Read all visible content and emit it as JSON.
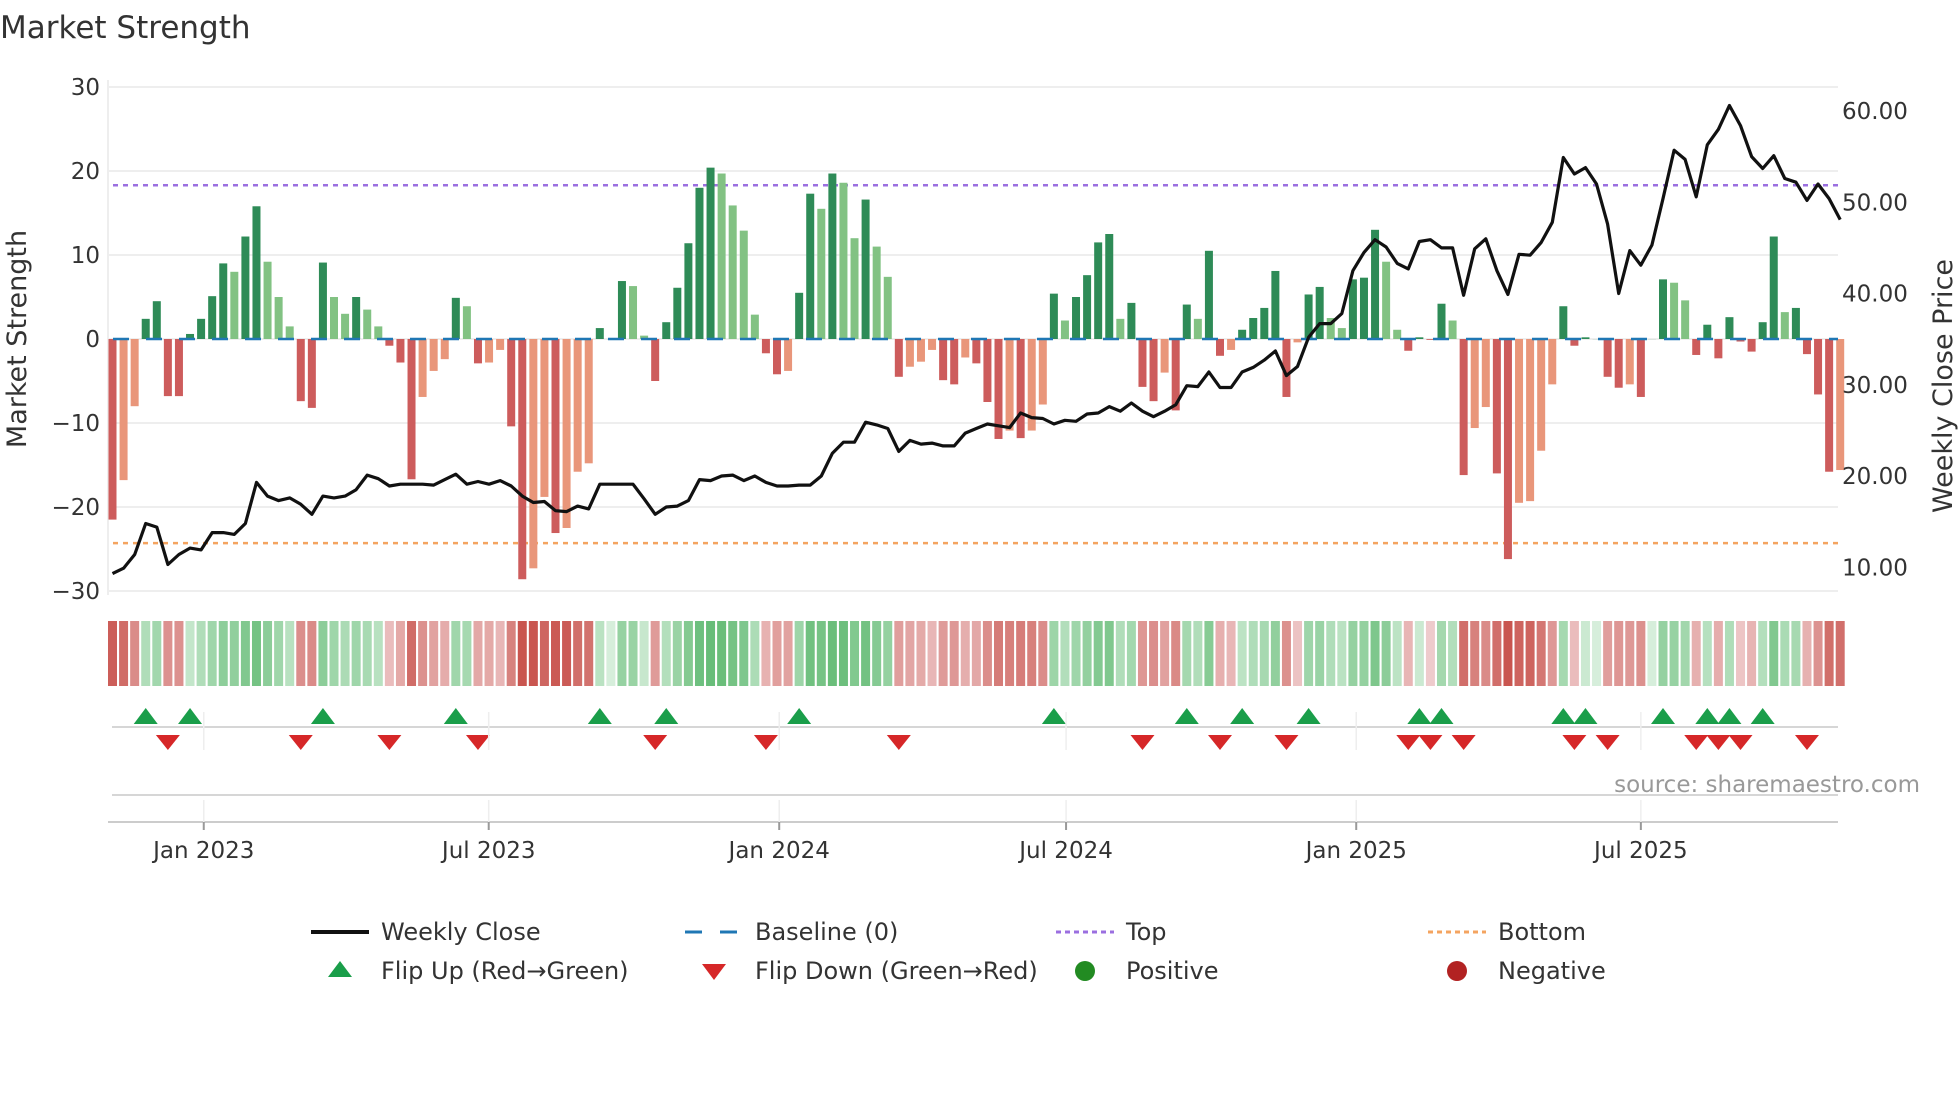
{
  "chart_data": {
    "type": "bar",
    "title": "Market Strength",
    "ylabel": "Market Strength",
    "y2label": "Weekly Close Price",
    "ylim": [
      -30,
      30
    ],
    "y2lim": [
      10,
      60
    ],
    "yticks": [
      "30",
      "20",
      "10",
      "0",
      "−10",
      "−20",
      "−30"
    ],
    "ytick_values": [
      30,
      20,
      10,
      0,
      -10,
      -20,
      -30
    ],
    "y2ticks": [
      "60.00",
      "50.00",
      "40.00",
      "30.00",
      "20.00",
      "10.00"
    ],
    "y2tick_values": [
      60,
      50,
      40,
      30,
      20,
      10
    ],
    "xticks": [
      {
        "label": "Jan 2023",
        "week": 8.24
      },
      {
        "label": "Jul 2023",
        "week": 33.97
      },
      {
        "label": "Jan 2024",
        "week": 60.2
      },
      {
        "label": "Jul 2024",
        "week": 86.1
      },
      {
        "label": "Jan 2025",
        "week": 112.3
      },
      {
        "label": "Jul 2025",
        "week": 138.0
      }
    ],
    "top_level": 18.3,
    "bottom_level": -24.3,
    "strength": [
      -21.5,
      -16.8,
      -8,
      2.4,
      4.5,
      -6.8,
      -6.8,
      0.6,
      2.4,
      5.1,
      9,
      8,
      12.2,
      15.8,
      9.2,
      5,
      1.5,
      -7.4,
      -8.2,
      9.1,
      5,
      3,
      5,
      3.5,
      1.5,
      -0.8,
      -2.8,
      -16.7,
      -6.9,
      -3.8,
      -2.4,
      4.9,
      3.9,
      -2.9,
      -2.8,
      -1.3,
      -10.4,
      -28.6,
      -27.3,
      -18.8,
      -23.1,
      -22.5,
      -15.8,
      -14.8,
      1.3,
      0,
      6.9,
      6.3,
      0.4,
      -5,
      2,
      6.1,
      11.4,
      18,
      20.4,
      19.7,
      15.9,
      12.9,
      2.9,
      -1.7,
      -4.2,
      -3.8,
      5.5,
      17.3,
      15.5,
      19.7,
      18.6,
      12,
      16.6,
      11,
      7.4,
      -4.5,
      -3.3,
      -2.7,
      -1.3,
      -4.9,
      -5.4,
      -2.2,
      -2.9,
      -7.5,
      -11.9,
      -10.9,
      -11.8,
      -10.9,
      -7.8,
      5.4,
      2.2,
      5,
      7.6,
      11.5,
      12.5,
      2.4,
      4.3,
      -5.7,
      -7.4,
      -4,
      -8.5,
      4.1,
      2.4,
      10.5,
      -2,
      -1.3,
      1.1,
      2.5,
      3.7,
      8.1,
      -6.9,
      -0.4,
      5.3,
      6.2,
      2.5,
      1.3,
      7.1,
      7.3,
      13,
      9.2,
      1.1,
      -1.4,
      0.2,
      -0.1,
      4.2,
      2.2,
      -16.2,
      -10.6,
      -8.1,
      -16,
      -26.2,
      -19.5,
      -19.3,
      -13.3,
      -5.4,
      3.9,
      -0.8,
      0.2,
      0,
      -4.5,
      -5.8,
      -5.4,
      -6.9,
      0,
      7.1,
      6.7,
      4.6,
      -1.9,
      1.7,
      -2.3,
      2.6,
      -0.3,
      -1.5,
      2,
      12.2,
      3.2,
      3.7,
      -1.8,
      -6.6,
      -15.8,
      -15.6
    ],
    "weekly_close": [
      9.3,
      9.9,
      11.4,
      14.8,
      14.4,
      10.3,
      11.4,
      12.1,
      11.9,
      13.8,
      13.8,
      13.6,
      14.8,
      19.3,
      17.8,
      17.3,
      17.6,
      16.9,
      15.8,
      17.8,
      17.6,
      17.8,
      18.5,
      20.1,
      19.7,
      18.9,
      19.1,
      19.1,
      19.1,
      19.0,
      19.6,
      20.2,
      19.1,
      19.4,
      19.1,
      19.5,
      18.9,
      17.8,
      17.1,
      17.2,
      16.2,
      16.1,
      16.7,
      16.4,
      19.1,
      19.1,
      19.1,
      19.1,
      17.5,
      15.8,
      16.6,
      16.7,
      17.3,
      19.6,
      19.5,
      20.0,
      20.1,
      19.5,
      20.0,
      19.3,
      18.9,
      18.9,
      19.0,
      19.0,
      20.0,
      22.5,
      23.7,
      23.7,
      25.9,
      25.6,
      25.2,
      22.7,
      23.9,
      23.5,
      23.6,
      23.3,
      23.3,
      24.7,
      25.2,
      25.7,
      25.5,
      25.3,
      26.9,
      26.4,
      26.3,
      25.7,
      26.1,
      26.0,
      26.8,
      26.9,
      27.6,
      27.1,
      28.0,
      27.1,
      26.5,
      27.1,
      27.8,
      29.9,
      29.8,
      31.4,
      29.7,
      29.7,
      31.4,
      31.9,
      32.7,
      33.7,
      31.0,
      32.0,
      35.2,
      36.7,
      36.7,
      37.8,
      42.5,
      44.5,
      45.9,
      45.1,
      43.3,
      42.7,
      45.7,
      45.9,
      45.0,
      45.0,
      39.8,
      44.9,
      46.0,
      42.5,
      39.9,
      44.3,
      44.2,
      45.6,
      47.8,
      54.9,
      53.1,
      53.8,
      52.0,
      47.6,
      40.0,
      44.7,
      43.1,
      45.3,
      50.4,
      55.7,
      54.7,
      50.6,
      56.3,
      58.0,
      60.6,
      58.4,
      55.0,
      53.7,
      55.1,
      52.6,
      52.2,
      50.2,
      52.0,
      50.4,
      48.1
    ],
    "flip_up_weeks": [
      3,
      7,
      19,
      31,
      44,
      50,
      62,
      85,
      97,
      102,
      108,
      118,
      120,
      131,
      133,
      140,
      144,
      146,
      149
    ],
    "flip_down_weeks": [
      5,
      17,
      25,
      33,
      49,
      59,
      71,
      93,
      100,
      106,
      117,
      119,
      122,
      132,
      135,
      143,
      145,
      147,
      153
    ],
    "legend": {
      "placement": "bottom",
      "items": [
        {
          "label": "Weekly Close",
          "kind": "line"
        },
        {
          "label": "Baseline (0)",
          "kind": "dash"
        },
        {
          "label": "Top",
          "kind": "dot-top"
        },
        {
          "label": "Bottom",
          "kind": "dot-bottom"
        },
        {
          "label": "Flip Up (Red→Green)",
          "kind": "tri-up"
        },
        {
          "label": "Flip Down (Green→Red)",
          "kind": "tri-down"
        },
        {
          "label": "Positive",
          "kind": "circle-pos"
        },
        {
          "label": "Negative",
          "kind": "circle-neg"
        }
      ]
    },
    "source": "source: sharemaestro.com",
    "colors": {
      "pos_strong": "#2e8b57",
      "pos_weak": "#82c283",
      "neg_strong": "#cd5c5c",
      "neg_weak": "#e9967a",
      "top": "#9b6fe0",
      "bottom": "#f4a460",
      "baseline": "#1f77b4",
      "close": "#111111",
      "flip_up": "#1a9e4a",
      "flip_down": "#d62728",
      "positive": "#228b22",
      "negative": "#b22222"
    }
  }
}
